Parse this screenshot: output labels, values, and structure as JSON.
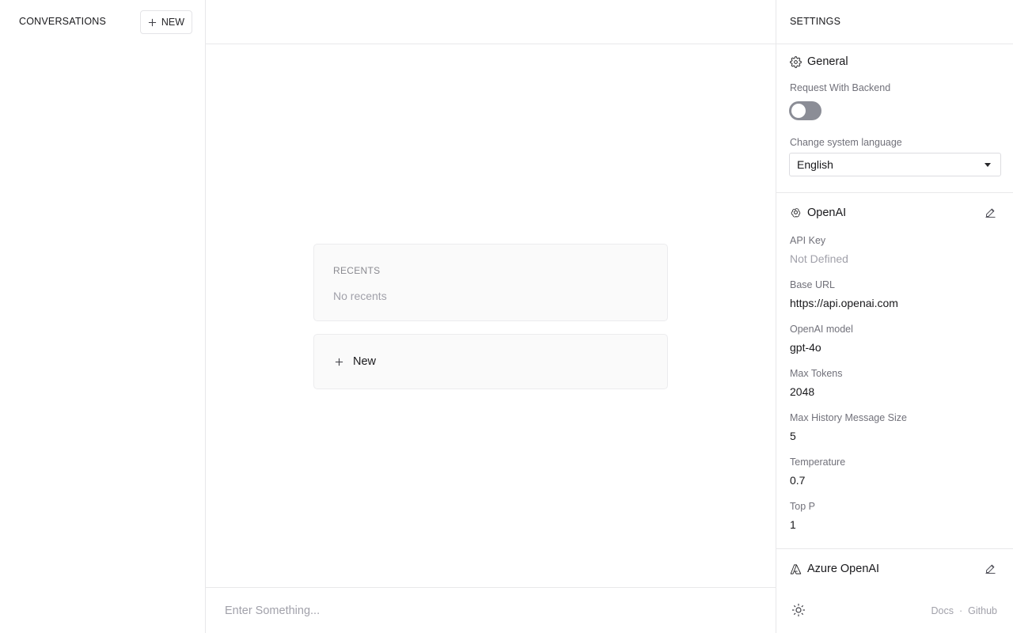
{
  "sidebar": {
    "title": "CONVERSATIONS",
    "new_button": {
      "label": "NEW",
      "icon": "plus-icon"
    }
  },
  "main": {
    "recents": {
      "title": "RECENTS",
      "empty_text": "No recents"
    },
    "new_card": {
      "label": "New",
      "icon": "plus-icon"
    },
    "input": {
      "placeholder": "Enter Something...",
      "value": ""
    }
  },
  "settings": {
    "title": "SETTINGS",
    "general": {
      "label": "General",
      "icon": "gear-icon",
      "request_with_backend": {
        "label": "Request With Backend",
        "enabled": false
      },
      "language": {
        "label": "Change system language",
        "value": "English"
      }
    },
    "openai": {
      "label": "OpenAI",
      "icon": "openai-logo-icon",
      "edit_icon": "pencil-icon",
      "fields": [
        {
          "label": "API Key",
          "value": "Not Defined"
        },
        {
          "label": "Base URL",
          "value": "https://api.openai.com"
        },
        {
          "label": "OpenAI model",
          "value": "gpt-4o"
        },
        {
          "label": "Max Tokens",
          "value": "2048"
        },
        {
          "label": "Max History Message Size",
          "value": "5"
        },
        {
          "label": "Temperature",
          "value": "0.7"
        },
        {
          "label": "Top P",
          "value": "1"
        }
      ]
    },
    "azure": {
      "label": "Azure OpenAI",
      "icon": "azure-logo-icon",
      "edit_icon": "pencil-icon"
    },
    "footer": {
      "theme_icon": "sun-icon",
      "docs_label": "Docs",
      "separator": "·",
      "github_label": "Github"
    }
  }
}
